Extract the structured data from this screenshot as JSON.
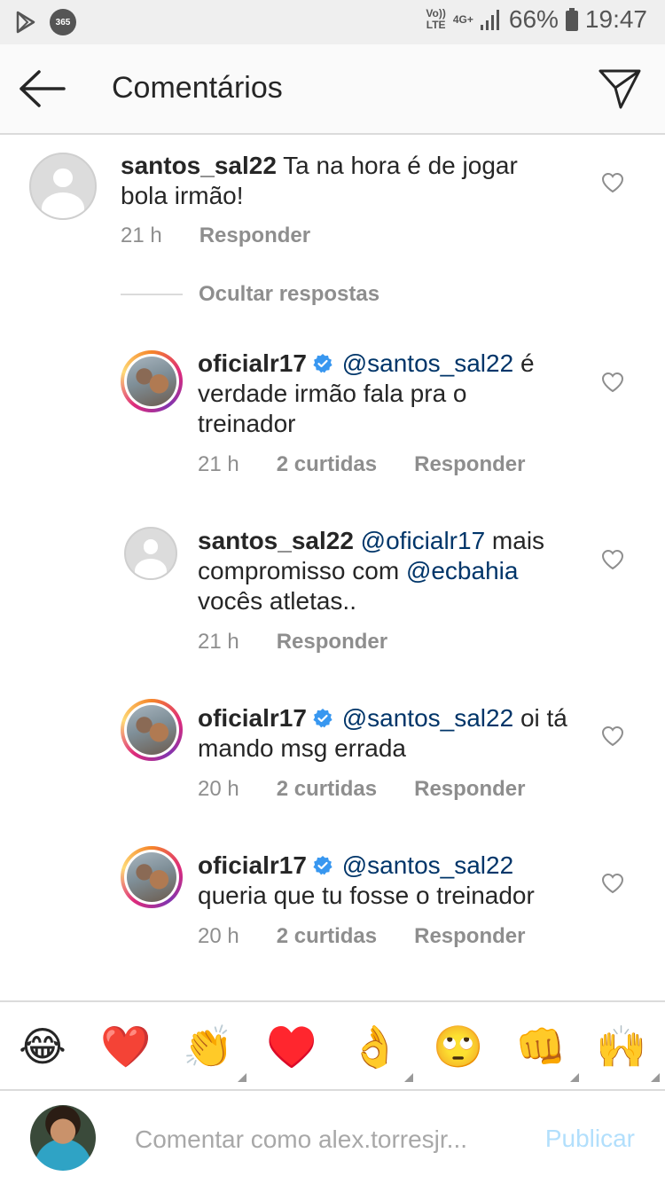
{
  "status_bar": {
    "app_badge": "365",
    "volte_top": "Vo))",
    "volte_bottom": "LTE",
    "network": "4G+",
    "battery": "66%",
    "time": "19:47"
  },
  "header": {
    "title": "Comentários"
  },
  "comments": [
    {
      "username": "santos_sal22",
      "text": " Ta na hora é de jogar bola irmão!",
      "time": "21 h",
      "reply_label": "Responder"
    }
  ],
  "hide_replies_label": "Ocultar respostas",
  "replies": [
    {
      "username": "oficialr17",
      "verified": true,
      "mention": "@santos_sal22",
      "text": " é verdade irmão  fala pra o treinador",
      "time": "21 h",
      "likes": "2 curtidas",
      "reply_label": "Responder"
    },
    {
      "username": "santos_sal22",
      "verified": false,
      "mention": "@oficialr17",
      "text_a": " mais compromisso com ",
      "mention_b": "@ecbahia",
      "text_b": " vocês atletas..",
      "time": "21 h",
      "reply_label": "Responder"
    },
    {
      "username": "oficialr17",
      "verified": true,
      "mention": "@santos_sal22",
      "text": " oi tá mando msg errada",
      "time": "20 h",
      "likes": "2 curtidas",
      "reply_label": "Responder"
    },
    {
      "username": "oficialr17",
      "verified": true,
      "mention": "@santos_sal22",
      "text": " queria que tu fosse o treinador",
      "time": "20 h",
      "likes": "2 curtidas",
      "reply_label": "Responder"
    }
  ],
  "emoji_bar": [
    "😂",
    "❤️",
    "👏",
    "♥️",
    "👌",
    "🙄",
    "👊",
    "🙌"
  ],
  "compose": {
    "placeholder": "Comentar como alex.torresjr...",
    "publish_label": "Publicar"
  },
  "colors": {
    "mention": "#003569",
    "meta": "#8e8e8e",
    "publish_disabled": "#b2dffc",
    "verified": "#3897f0"
  }
}
